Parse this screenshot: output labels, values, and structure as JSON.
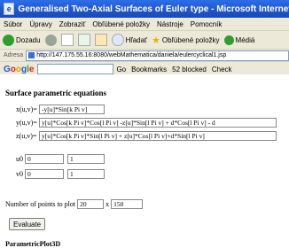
{
  "window": {
    "title": "Generalised Two-Axial Surfaces of Euler type - Microsoft Internet Explorer"
  },
  "menu": [
    "Súbor",
    "Úpravy",
    "Zobraziť",
    "Obľúbené položky",
    "Nástroje",
    "Pomocník"
  ],
  "toolbar": {
    "back_label": "Dozadu",
    "search_label": "Hľadať",
    "favorites_label": "Obľúbené položky",
    "media_label": "Médiá"
  },
  "address": {
    "label": "Adresa",
    "url": "http://147.175.55.16:8080/webMathematica/daniela/eulercyclical1.jsp"
  },
  "googlebar": {
    "logo": "Google",
    "go_label": "Go",
    "bookmarks_label": "Bookmarks",
    "blocked_label": "52 blocked",
    "check_label": "Check"
  },
  "form": {
    "section_title": "Surface parametric equations",
    "eq_x_label": "x(u,v)=",
    "eq_x_value": "-y[u]*Sin[k Pi v]",
    "eq_y_label": "y(u,v)=",
    "eq_y_value": "y[u]*Cos[k Pi v]*Cos[l Pi v] -z[u]*Sin[l Pi v] + d*Cos[l Pi v] - d",
    "eq_z_label": "z(u,v)=",
    "eq_z_value": "y[u]*Cos[k Pi v]*Sin[l Pi v] + z[u]*Cos[l Pi v]+d*Sin[l Pi v]",
    "u0_label": "u0",
    "u0_from": "0",
    "u0_to": "1",
    "v0_label": "v0",
    "v0_from": "0",
    "v0_to": "1",
    "npoints_label": "Number of points to plot",
    "npoints_u": "20",
    "npoints_sep": "x",
    "npoints_v": "150",
    "evaluate_label": "Evaluate",
    "footer_title": "ParametricPlot3D"
  }
}
